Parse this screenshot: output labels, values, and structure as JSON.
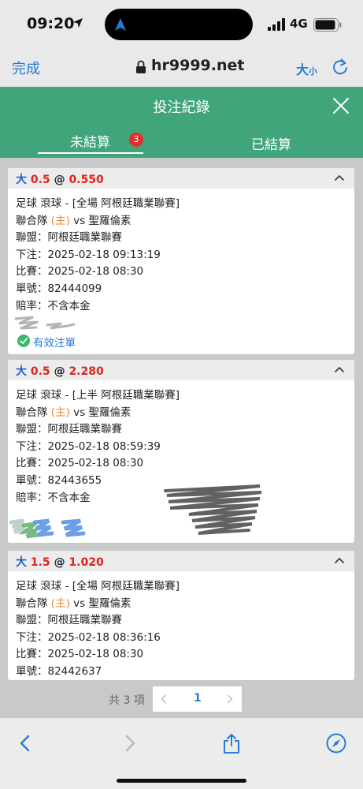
{
  "status_bar": {
    "time": "09:20",
    "network": "4G"
  },
  "browser": {
    "done_label": "完成",
    "url": "hr9999.net",
    "text_size_big": "大",
    "text_size_small": "小"
  },
  "header": {
    "title": "投注紀錄"
  },
  "tabs": [
    {
      "label": "未結算",
      "badge": "3",
      "active": true
    },
    {
      "label": "已結算",
      "active": false
    }
  ],
  "bets": [
    {
      "pick": "大",
      "handicap": "0.5",
      "at": "@",
      "odds": "0.550",
      "event": "足球 滾球 - [全場 阿根廷職業聯賽]",
      "home_team": "聯合隊",
      "home_tag": "(主)",
      "vs": "vs",
      "away_team": "聖羅倫素",
      "league": "聯盟：阿根廷職業聯賽",
      "placed": "下注：2025-02-18 09:13:19",
      "match_time": "比賽：2025-02-18 08:30",
      "ticket": "單號：82444099",
      "odds_type": "賠率：不含本金",
      "status": "有效注單"
    },
    {
      "pick": "大",
      "handicap": "0.5",
      "at": "@",
      "odds": "2.280",
      "event": "足球 滾球 - [上半 阿根廷職業聯賽]",
      "home_team": "聯合隊",
      "home_tag": "(主)",
      "vs": "vs",
      "away_team": "聖羅倫素",
      "league": "聯盟：阿根廷職業聯賽",
      "placed": "下注：2025-02-18 08:59:39",
      "match_time": "比賽：2025-02-18 08:30",
      "ticket": "單號：82443655",
      "odds_type": "賠率：不含本金"
    },
    {
      "pick": "大",
      "handicap": "1.5",
      "at": "@",
      "odds": "1.020",
      "event": "足球 滾球 - [全場 阿根廷職業聯賽]",
      "home_team": "聯合隊",
      "home_tag": "(主)",
      "vs": "vs",
      "away_team": "聖羅倫素",
      "league": "聯盟：阿根廷職業聯賽",
      "placed": "下注：2025-02-18 08:36:16",
      "match_time": "比賽：2025-02-18 08:30",
      "ticket": "單號：82442637"
    }
  ],
  "pagination": {
    "total": "共 3 項",
    "current_page": "1"
  },
  "colors": {
    "header_green": "#41a57b",
    "link_blue": "#2a7bd6",
    "odds_red": "#e0241a",
    "badge_red": "#e0302e"
  }
}
